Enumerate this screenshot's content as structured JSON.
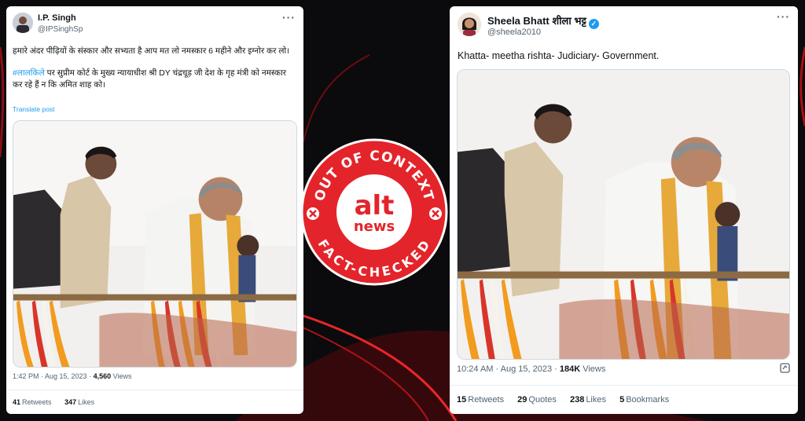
{
  "left_tweet": {
    "display_name": "I.P. Singh",
    "handle": "@IPSinghSp",
    "para1": "हमारे अंदर पीढ़ियों के संस्कार और सभ्यता है आप मत लो नमस्कार 6 महीने और इग्नोर कर लो।",
    "hashtag": "#लालकिले",
    "para2_rest": " पर सुप्रीम कोर्ट के मुख्य न्यायाधीश श्री DY चंद्रचूड़ जी देश के गृह मंत्री को नमस्कार कर रहे हैं न कि अमित शाह को।",
    "translate_label": "Translate post",
    "time": "1:42 PM · Aug 15, 2023 · ",
    "views_count": "4,560",
    "views_label": " Views",
    "retweets_count": "41",
    "retweets_label": "Retweets",
    "likes_count": "347",
    "likes_label": "Likes"
  },
  "right_tweet": {
    "display_name": "Sheela Bhatt शीला भट्ट",
    "handle": "@sheela2010",
    "text": "Khatta- meetha rishta- Judiciary- Government.",
    "time": "10:24 AM · Aug 15, 2023 · ",
    "views_count": "184K",
    "views_label": " Views",
    "retweets_count": "15",
    "retweets_label": "Retweets",
    "quotes_count": "29",
    "quotes_label": "Quotes",
    "likes_count": "238",
    "likes_label": "Likes",
    "bookmarks_count": "5",
    "bookmarks_label": "Bookmarks"
  },
  "badge": {
    "top_text": "OUT OF CONTEXT",
    "bottom_text": "FACT-CHECKED",
    "logo_top": "alt",
    "logo_bottom": "news"
  },
  "colors": {
    "badge_red": "#e3242b",
    "verified_blue": "#1d9bf0",
    "link_blue": "#1d9bf0"
  },
  "icons": [
    "more-icon",
    "verified-icon",
    "grok-icon",
    "x-mark-icon"
  ]
}
